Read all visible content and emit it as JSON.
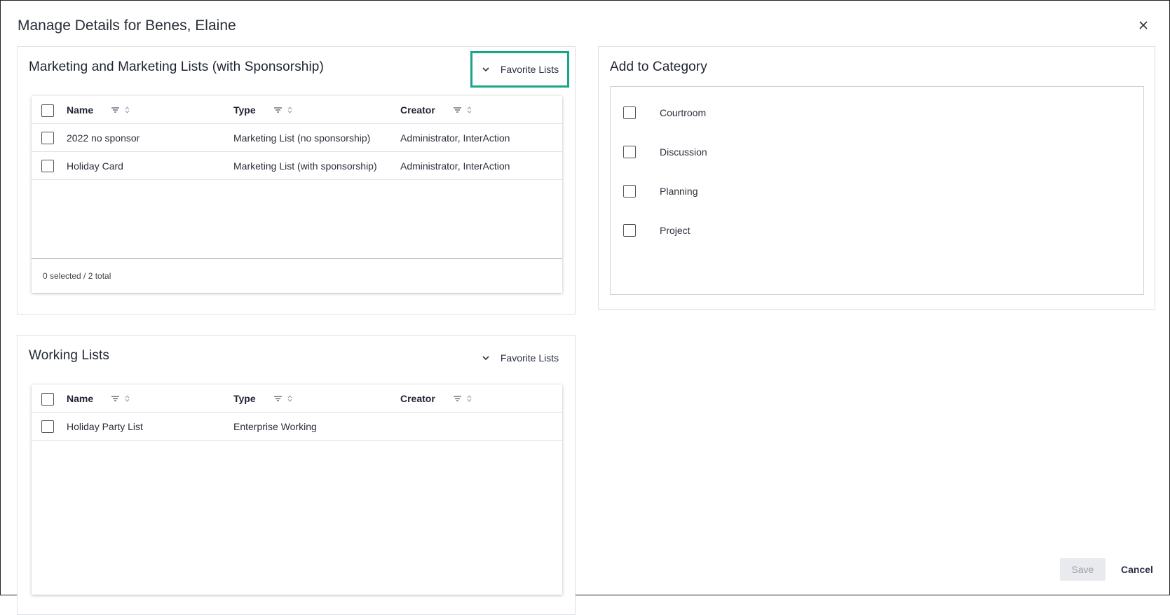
{
  "dialog": {
    "title": "Manage Details for Benes, Elaine",
    "close_icon": "close-icon"
  },
  "marketing": {
    "title": "Marketing and Marketing Lists (with Sponsorship)",
    "favorite_label": "Favorite Lists",
    "columns": [
      "Name",
      "Type",
      "Creator"
    ],
    "rows": [
      {
        "name": "2022 no sponsor",
        "type": "Marketing List (no sponsorship)",
        "creator": "Administrator, InterAction"
      },
      {
        "name": "Holiday Card",
        "type": "Marketing List (with sponsorship)",
        "creator": "Administrator, InterAction"
      }
    ],
    "footer": "0 selected / 2 total"
  },
  "working": {
    "title": "Working Lists",
    "favorite_label": "Favorite Lists",
    "columns": [
      "Name",
      "Type",
      "Creator"
    ],
    "rows": [
      {
        "name": "Holiday Party List",
        "type": "Enterprise Working",
        "creator": ""
      }
    ]
  },
  "category": {
    "title": "Add to Category",
    "items": [
      "Courtroom",
      "Discussion",
      "Planning",
      "Project"
    ]
  },
  "actions": {
    "save_label": "Save",
    "cancel_label": "Cancel"
  },
  "colors": {
    "focus_ring": "#1aa58a",
    "save_disabled_bg": "#e8eaed"
  }
}
